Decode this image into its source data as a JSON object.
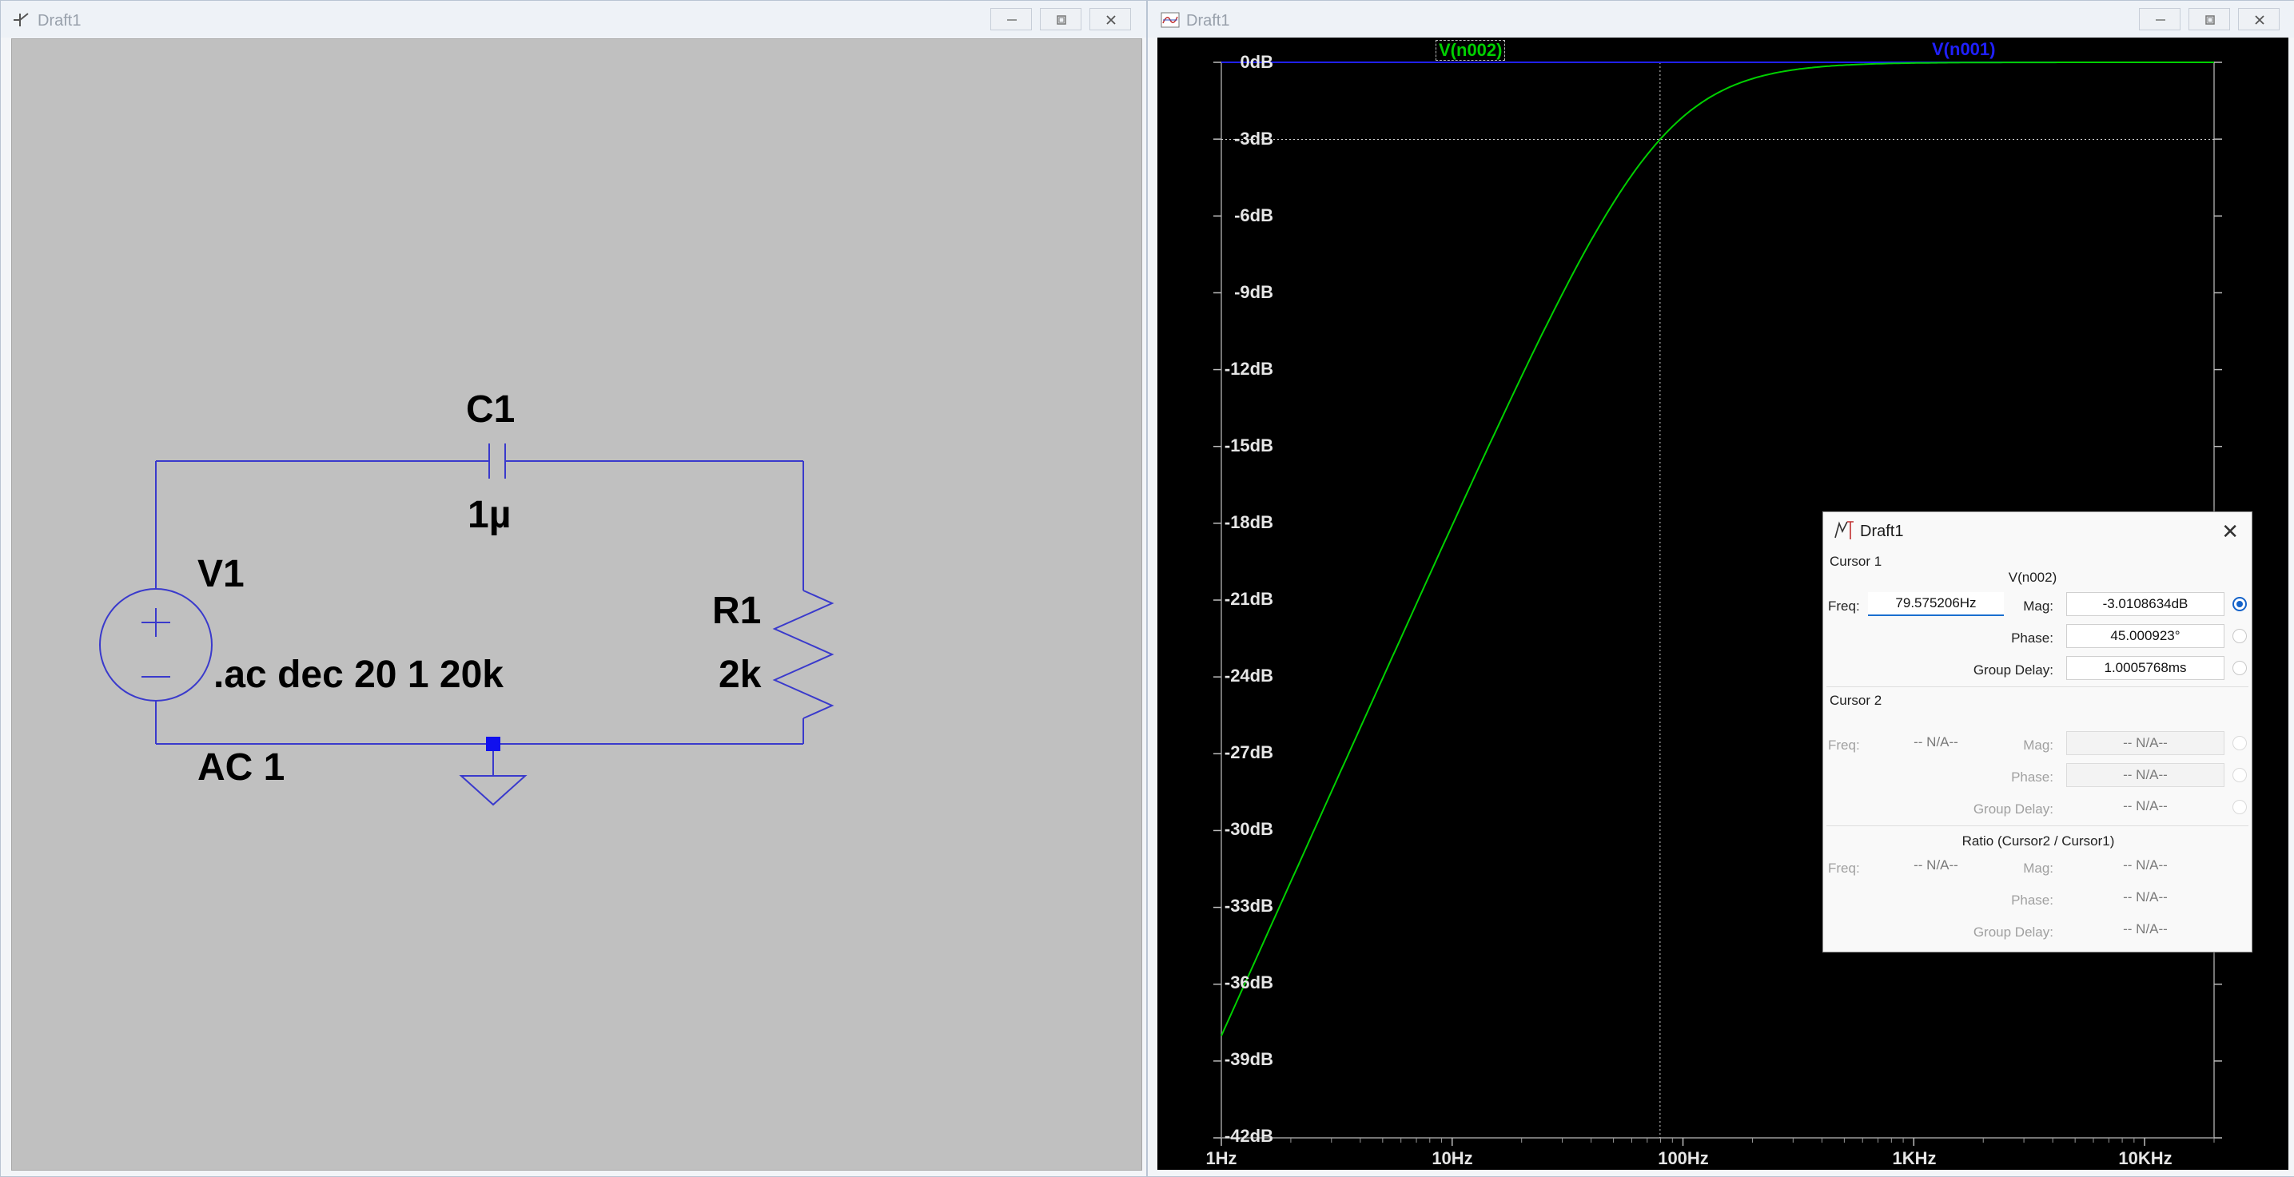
{
  "schematic_window": {
    "title": "Draft1",
    "icon": "schematic-icon"
  },
  "waveform_window": {
    "title": "Draft1",
    "icon": "waveform-icon"
  },
  "schematic": {
    "capacitor": {
      "name": "C1",
      "value": "1µ"
    },
    "source": {
      "name": "V1",
      "value": "AC 1"
    },
    "resistor": {
      "name": "R1",
      "value": "2k"
    },
    "directive": ".ac dec 20 1 20k",
    "wire_color": "#3a3acc"
  },
  "plot": {
    "traces": [
      {
        "label": "V(n002)",
        "color": "#00d000"
      },
      {
        "label": "V(n001)",
        "color": "#2020ff"
      }
    ],
    "y_ticks": [
      "0dB",
      "-3dB",
      "-6dB",
      "-9dB",
      "-12dB",
      "-15dB",
      "-18dB",
      "-21dB",
      "-24dB",
      "-27dB",
      "-30dB",
      "-33dB",
      "-36dB",
      "-39dB",
      "-42dB"
    ],
    "x_ticks": [
      "1Hz",
      "10Hz",
      "100Hz",
      "1KHz",
      "10KHz"
    ]
  },
  "chart_data": {
    "type": "line",
    "xscale": "log",
    "xlim_hz": [
      1,
      20000
    ],
    "ylim_db": [
      -42,
      0
    ],
    "series": [
      {
        "name": "V(n002)",
        "cutoff_hz": 79.575,
        "x_hz": [
          1,
          2,
          5,
          10,
          20,
          50,
          79.575,
          100,
          200,
          500,
          1000,
          2000,
          5000,
          10000,
          20000
        ],
        "y_db": [
          -38.0,
          -32.0,
          -24.1,
          -18.1,
          -12.3,
          -4.5,
          -3.01,
          -2.1,
          -0.7,
          -0.12,
          -0.03,
          -0.01,
          0,
          0,
          0
        ]
      },
      {
        "name": "V(n001)",
        "x_hz": [
          1,
          20000
        ],
        "y_db": [
          0,
          0
        ]
      }
    ],
    "cursor": {
      "x_hz": 79.575,
      "y_db": -3.01
    }
  },
  "cursor_dialog": {
    "title": "Draft1",
    "cursor1": {
      "heading": "Cursor 1",
      "trace": "V(n002)",
      "freq_label": "Freq:",
      "freq": "79.575206Hz",
      "mag_label": "Mag:",
      "mag": "-3.0108634dB",
      "phase_label": "Phase:",
      "phase": "45.000923°",
      "gd_label": "Group Delay:",
      "gd": "1.0005768ms"
    },
    "cursor2": {
      "heading": "Cursor 2",
      "freq_label": "Freq:",
      "freq": "-- N/A--",
      "mag_label": "Mag:",
      "mag": "-- N/A--",
      "phase_label": "Phase:",
      "phase": "-- N/A--",
      "gd_label": "Group Delay:",
      "gd": "-- N/A--"
    },
    "ratio": {
      "heading": "Ratio (Cursor2 / Cursor1)",
      "freq_label": "Freq:",
      "freq": "-- N/A--",
      "mag_label": "Mag:",
      "mag": "-- N/A--",
      "phase_label": "Phase:",
      "phase": "-- N/A--",
      "gd_label": "Group Delay:",
      "gd": "-- N/A--"
    }
  }
}
